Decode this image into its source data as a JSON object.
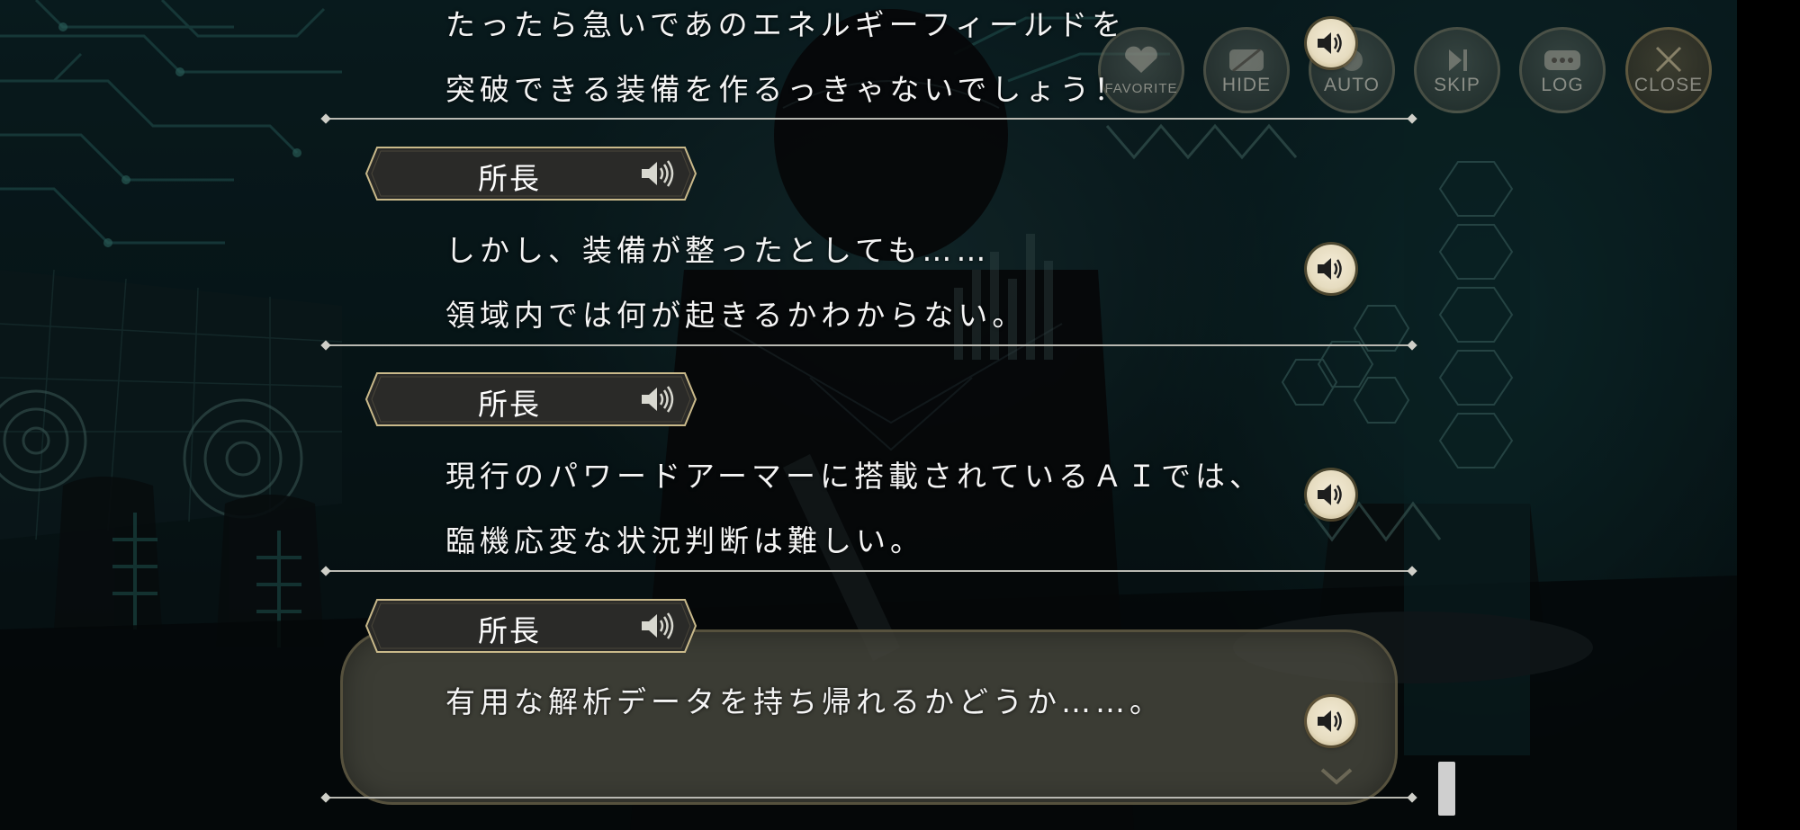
{
  "controls": {
    "favorite": {
      "label": "FAVORITE",
      "icon": "heart-icon"
    },
    "hide": {
      "label": "HIDE",
      "icon": "hide-icon"
    },
    "auto": {
      "label": "AUTO",
      "icon": "auto-icon"
    },
    "skip": {
      "label": "SKIP",
      "icon": "skip-icon"
    },
    "log": {
      "label": "LOG",
      "icon": "chat-bubble-icon"
    },
    "close": {
      "label": "CLOSE",
      "icon": "close-icon"
    }
  },
  "log": {
    "entries": [
      {
        "speaker": "",
        "lines": [
          "たったら急いであのエネルギーフィールドを",
          "突破できる装備を作るっきゃないでしょう！"
        ]
      },
      {
        "speaker": "所長",
        "lines": [
          "しかし、装備が整ったとしても……",
          "領域内では何が起きるかわからない。"
        ]
      },
      {
        "speaker": "所長",
        "lines": [
          "現行のパワードアーマーに搭載されているＡＩでは、",
          "臨機応変な状況判断は難しい。"
        ]
      },
      {
        "speaker": "所長",
        "lines": [
          "有用な解析データを持ち帰れるかどうか……。"
        ]
      }
    ]
  },
  "colors": {
    "accent_gold": "#c9b98a",
    "text": "#f4f4f4",
    "background": "#0b2226"
  }
}
